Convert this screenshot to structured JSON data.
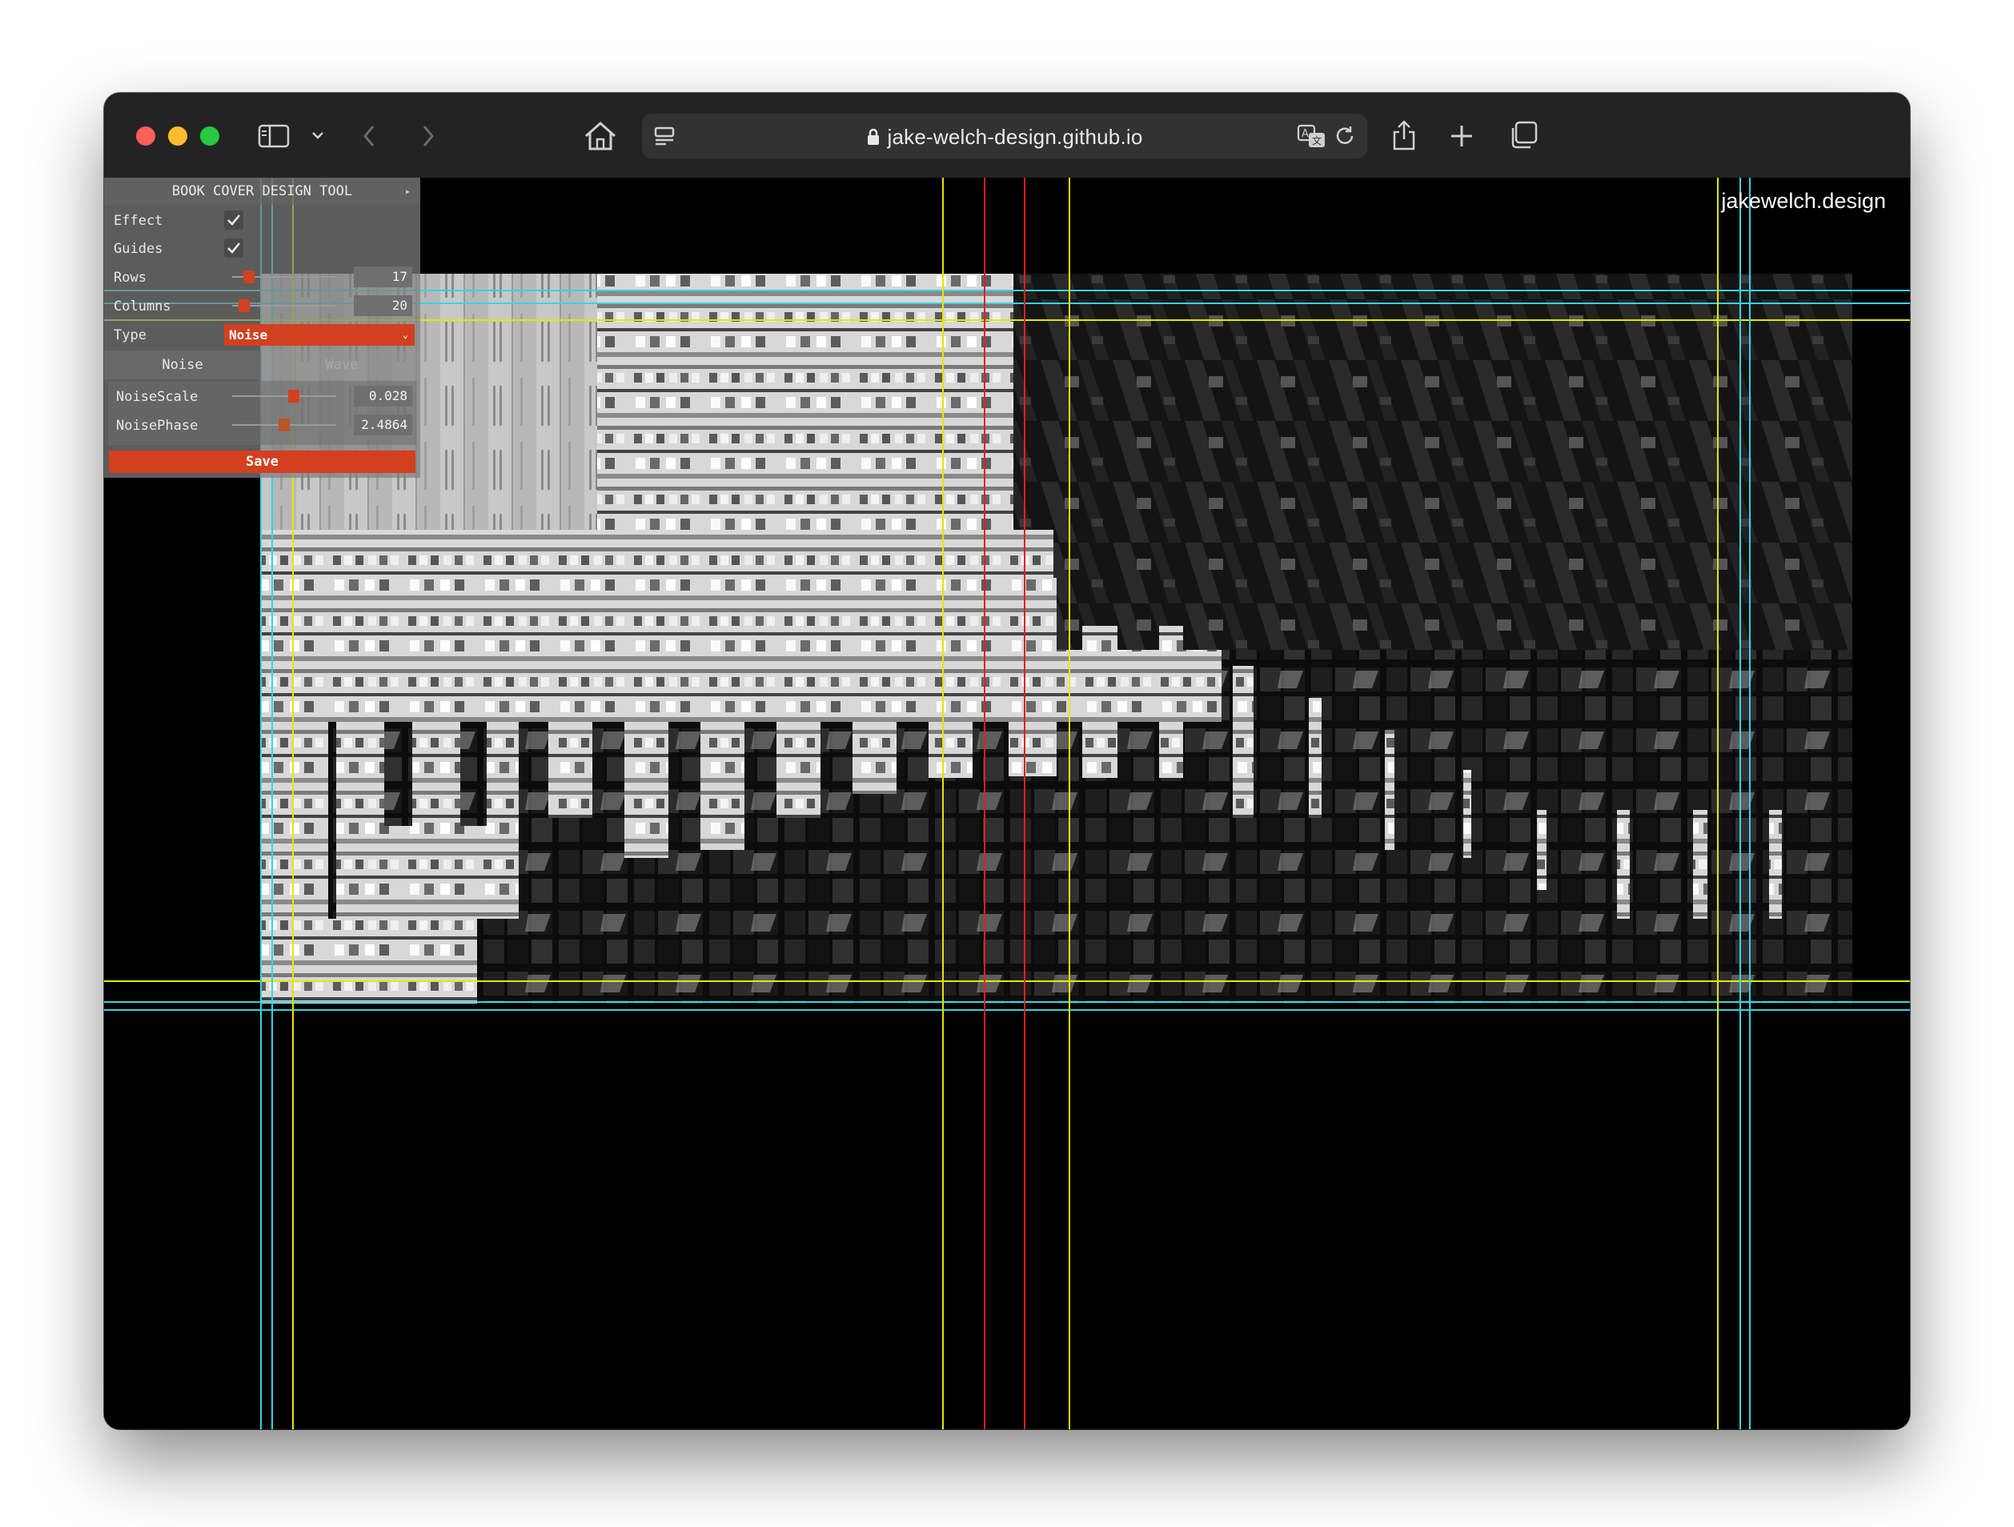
{
  "browser": {
    "url": "jake-welch-design.github.io",
    "icons": [
      "sidebar-icon",
      "chevron-down-icon",
      "back-icon",
      "forward-icon",
      "home-icon",
      "tab-overview-icon",
      "lock-icon",
      "translate-icon",
      "reload-icon",
      "share-icon",
      "plus-icon",
      "tabs-icon"
    ]
  },
  "page": {
    "brand": "jakewelch.design"
  },
  "gui": {
    "title": "BOOK COVER DESIGN TOOL",
    "effect_label": "Effect",
    "effect_checked": true,
    "guides_label": "Guides",
    "guides_checked": true,
    "rows_label": "Rows",
    "rows_value": "17",
    "columns_label": "Columns",
    "columns_value": "20",
    "type_label": "Type",
    "type_value": "Noise",
    "tab_noise": "Noise",
    "tab_wave": "Wave",
    "noise_scale_label": "NoiseScale",
    "noise_scale_value": "0.028",
    "noise_phase_label": "NoisePhase",
    "noise_phase_value": "2.4864",
    "save_label": "Save"
  },
  "colors": {
    "accent": "#d2401f",
    "guide_yellow": "#e6e600",
    "guide_cyan": "#35d4e0",
    "guide_red": "#e02020"
  }
}
